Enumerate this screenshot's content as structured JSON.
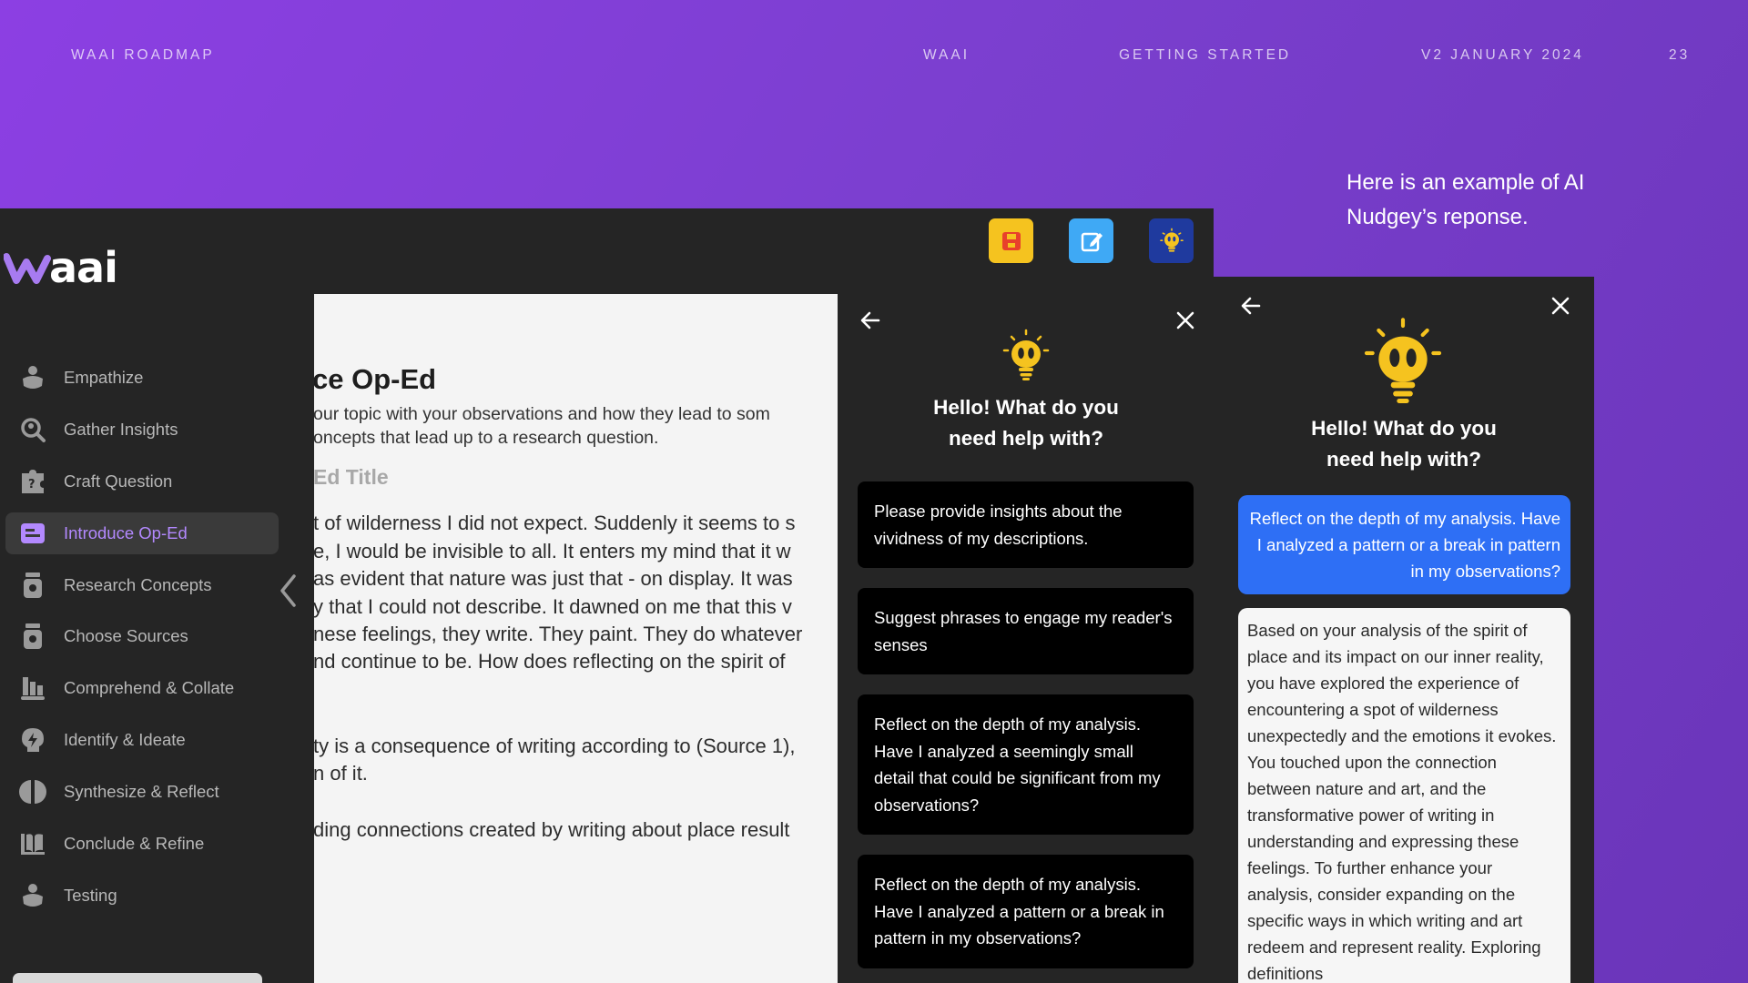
{
  "header": {
    "left": "WAAI ROADMAP",
    "brand": "WAAI",
    "section": "GETTING STARTED",
    "version": "V2 JANUARY 2024",
    "page": "23"
  },
  "caption": "Here is an example of AI Nudgey’s reponse.",
  "app": {
    "logo_text": "aai",
    "top_icons": [
      {
        "name": "save-icon",
        "color": "#f5c31f"
      },
      {
        "name": "edit-icon",
        "color": "#3fa9f5"
      },
      {
        "name": "nudgey-icon",
        "color": "#1f3a9e"
      }
    ],
    "sidebar": {
      "items": [
        {
          "label": "Empathize"
        },
        {
          "label": "Gather Insights"
        },
        {
          "label": "Craft Question"
        },
        {
          "label": "Introduce Op-Ed"
        },
        {
          "label": "Research Concepts"
        },
        {
          "label": "Choose Sources"
        },
        {
          "label": "Comprehend & Collate"
        },
        {
          "label": "Identify & Ideate"
        },
        {
          "label": "Synthesize & Reflect"
        },
        {
          "label": "Conclude & Refine"
        },
        {
          "label": "Testing"
        }
      ],
      "active_index": 3
    },
    "doc": {
      "title": "ce Op-Ed",
      "intro_1": "our topic with your observations and how they lead to som",
      "intro_2": "oncepts that lead up to a research question.",
      "subtitle": "Ed Title",
      "para": [
        "t of wilderness I did not expect. Suddenly it seems to s",
        "e, I would be invisible to all. It enters my mind that it w",
        "as evident that nature was just that - on display. It was",
        "y that I could not describe. It dawned on me that this v",
        "nese feelings, they write. They paint. They do whatever",
        "nd continue to be. How does reflecting on the spirit of"
      ],
      "para2": [
        "ty is a consequence of writing according to (Source 1),",
        "n of it."
      ],
      "para3": "ding connections created by writing about place result"
    },
    "chat": {
      "greeting_1": "Hello! What do you",
      "greeting_2": "need help with?",
      "suggestions": [
        "Please provide insights about the vividness of my descriptions.",
        "Suggest phrases to engage my reader's senses",
        "Reflect on the depth of my analysis. Have I analyzed a seemingly small detail that could be significant from my observations?",
        "Reflect on the depth of my analysis. Have I analyzed a pattern or a break in pattern in my observations?"
      ]
    }
  },
  "zoom": {
    "greeting_1": "Hello! What do you",
    "greeting_2": "need help with?",
    "user_message": "Reflect on the depth of my analysis. Have I analyzed a pattern or a break in pattern in my observations?",
    "bot_message": "Based on your analysis of the spirit of place and its impact on our inner reality, you have explored the experience of encountering a spot of wilderness unexpectedly and the emotions it evokes. You touched upon the connection between nature and art, and the transformative power of writing in understanding and expressing these feelings. To further enhance your analysis, consider expanding on the specific ways in which writing and art redeem and represent reality. Exploring definitions"
  }
}
